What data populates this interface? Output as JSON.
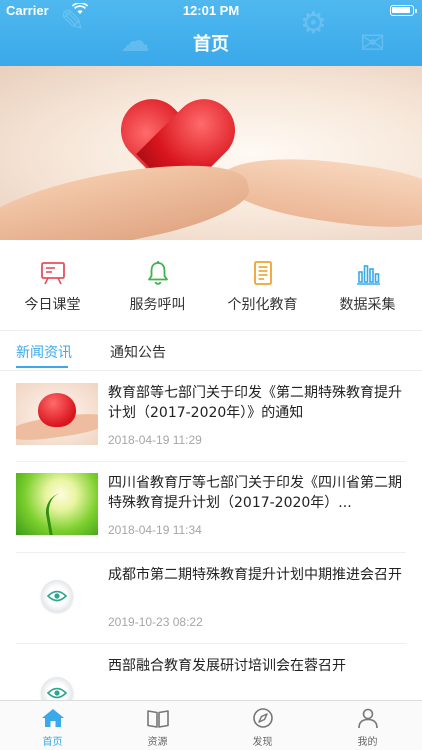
{
  "status_bar": {
    "carrier": "Carrier",
    "time": "12:01 PM"
  },
  "nav": {
    "title": "首页"
  },
  "quick_menu": [
    {
      "label": "今日课堂",
      "icon": "blackboard-icon",
      "color": "#e6505c"
    },
    {
      "label": "服务呼叫",
      "icon": "bell-icon",
      "color": "#3db34a"
    },
    {
      "label": "个别化教育",
      "icon": "document-icon",
      "color": "#f0a22e"
    },
    {
      "label": "数据采集",
      "icon": "bar-chart-icon",
      "color": "#3aa9ea"
    }
  ],
  "tabs": [
    {
      "label": "新闻资讯",
      "active": true
    },
    {
      "label": "通知公告",
      "active": false
    }
  ],
  "news": [
    {
      "title": "教育部等七部门关于印发《第二期特殊教育提升计划（2017-2020年）》的通知",
      "date": "2018-04-19 11:29",
      "thumb": "heart-hands-image"
    },
    {
      "title": "四川省教育厅等七部门关于印发《四川省第二期特殊教育提升计划（2017-2020年）...",
      "date": "2018-04-19 11:34",
      "thumb": "green-sprout-image"
    },
    {
      "title": "成都市第二期特殊教育提升计划中期推进会召开",
      "date": "2019-10-23 08:22",
      "thumb": "eye-logo-image"
    },
    {
      "title": "西部融合教育发展研讨培训会在蓉召开",
      "date": "",
      "thumb": "eye-logo-image"
    }
  ],
  "tab_bar": [
    {
      "label": "首页",
      "icon": "home-icon",
      "active": true
    },
    {
      "label": "资源",
      "icon": "book-icon",
      "active": false
    },
    {
      "label": "发现",
      "icon": "compass-icon",
      "active": false
    },
    {
      "label": "我的",
      "icon": "person-icon",
      "active": false
    }
  ],
  "colors": {
    "accent": "#3aa9ea",
    "header": "#4fb8ef",
    "date_gray": "#a6a6a6"
  }
}
